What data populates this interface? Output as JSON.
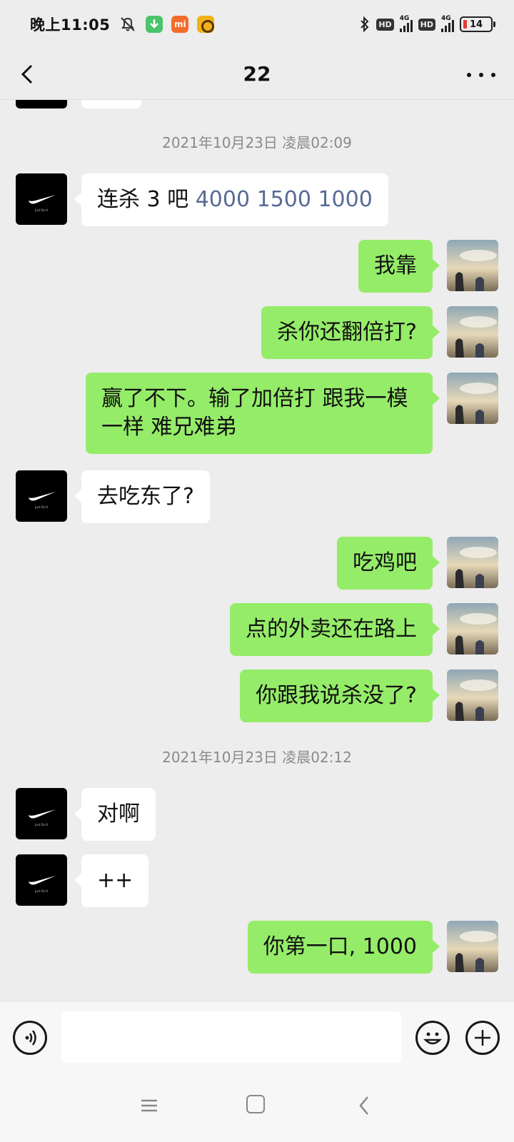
{
  "status": {
    "time": "晚上11:05",
    "network1": "4G",
    "network2": "4G",
    "hd": "HD",
    "battery": "14",
    "mi_label": "mi"
  },
  "header": {
    "title": "22"
  },
  "timestamps": {
    "t1": "2021年10月23日 凌晨02:09",
    "t2": "2021年10月23日 凌晨02:12"
  },
  "messages": [
    {
      "side": "left",
      "text_prefix": "连杀 3 吧 ",
      "link_text": "4000 1500 1000"
    },
    {
      "side": "right",
      "text": "我靠"
    },
    {
      "side": "right",
      "text": "杀你还翻倍打?"
    },
    {
      "side": "right",
      "text": "赢了不下。输了加倍打  跟我一模一样 难兄难弟"
    },
    {
      "side": "left",
      "text": "去吃东了?"
    },
    {
      "side": "right",
      "text": "吃鸡吧"
    },
    {
      "side": "right",
      "text": "点的外卖还在路上"
    },
    {
      "side": "right",
      "text": "你跟我说杀没了?"
    },
    {
      "side": "left",
      "text": "对啊"
    },
    {
      "side": "left",
      "text": "++"
    },
    {
      "side": "right",
      "text": "你第一口, 1000"
    }
  ],
  "avatars": {
    "contact_text": "Just Do It"
  },
  "icons": {
    "back": "back-arrow-icon",
    "more": "more-icon",
    "voice": "voice-icon",
    "emoji": "emoji-icon",
    "plus": "plus-icon"
  },
  "colors": {
    "sent_bubble": "#95ec69",
    "received_bubble": "#ffffff",
    "background": "#ededed",
    "link": "#576b95"
  }
}
